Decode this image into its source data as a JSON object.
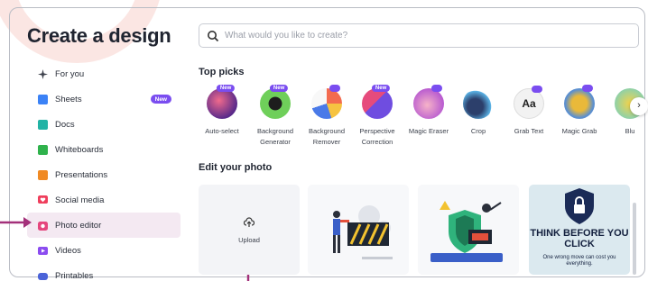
{
  "header": {
    "title": "Create a design",
    "search_placeholder": "What would you like to create?"
  },
  "sidebar": {
    "items": [
      {
        "label": "For you",
        "icon": "sparkle-icon",
        "color": "#3b3f4a"
      },
      {
        "label": "Sheets",
        "icon": "sheets-icon",
        "color": "#3b82f6",
        "badge": "New"
      },
      {
        "label": "Docs",
        "icon": "docs-icon",
        "color": "#22b3a5"
      },
      {
        "label": "Whiteboards",
        "icon": "whiteboard-icon",
        "color": "#2fb24c"
      },
      {
        "label": "Presentations",
        "icon": "presentation-icon",
        "color": "#f08a24"
      },
      {
        "label": "Social media",
        "icon": "heart-icon",
        "color": "#ef3e5c"
      },
      {
        "label": "Photo editor",
        "icon": "camera-icon",
        "color": "#e5467d",
        "active": true
      },
      {
        "label": "Videos",
        "icon": "video-icon",
        "color": "#8b4cf0"
      },
      {
        "label": "Printables",
        "icon": "print-icon",
        "color": "#4b63d8"
      }
    ]
  },
  "top_picks": {
    "title": "Top picks",
    "items": [
      {
        "label": "Auto-select",
        "badge": "New"
      },
      {
        "label": "Background Generator",
        "badge": "New"
      },
      {
        "label": "Background Remover",
        "badge": ""
      },
      {
        "label": "Perspective Correction",
        "badge": "New"
      },
      {
        "label": "Magic Eraser",
        "badge": ""
      },
      {
        "label": "Crop",
        "badge": ""
      },
      {
        "label": "Grab Text",
        "badge": ""
      },
      {
        "label": "Magic Grab",
        "badge": ""
      },
      {
        "label": "Blu",
        "badge": ""
      }
    ]
  },
  "edit_photo": {
    "title": "Edit your photo",
    "upload_label": "Upload",
    "card_think_heading": "THINK BEFORE YOU CLICK",
    "card_think_sub": "One wrong move can cost you everything."
  },
  "colors": {
    "accent": "#7a4df0",
    "active_bg": "#f4e9f2",
    "arrow": "#a3307a"
  }
}
